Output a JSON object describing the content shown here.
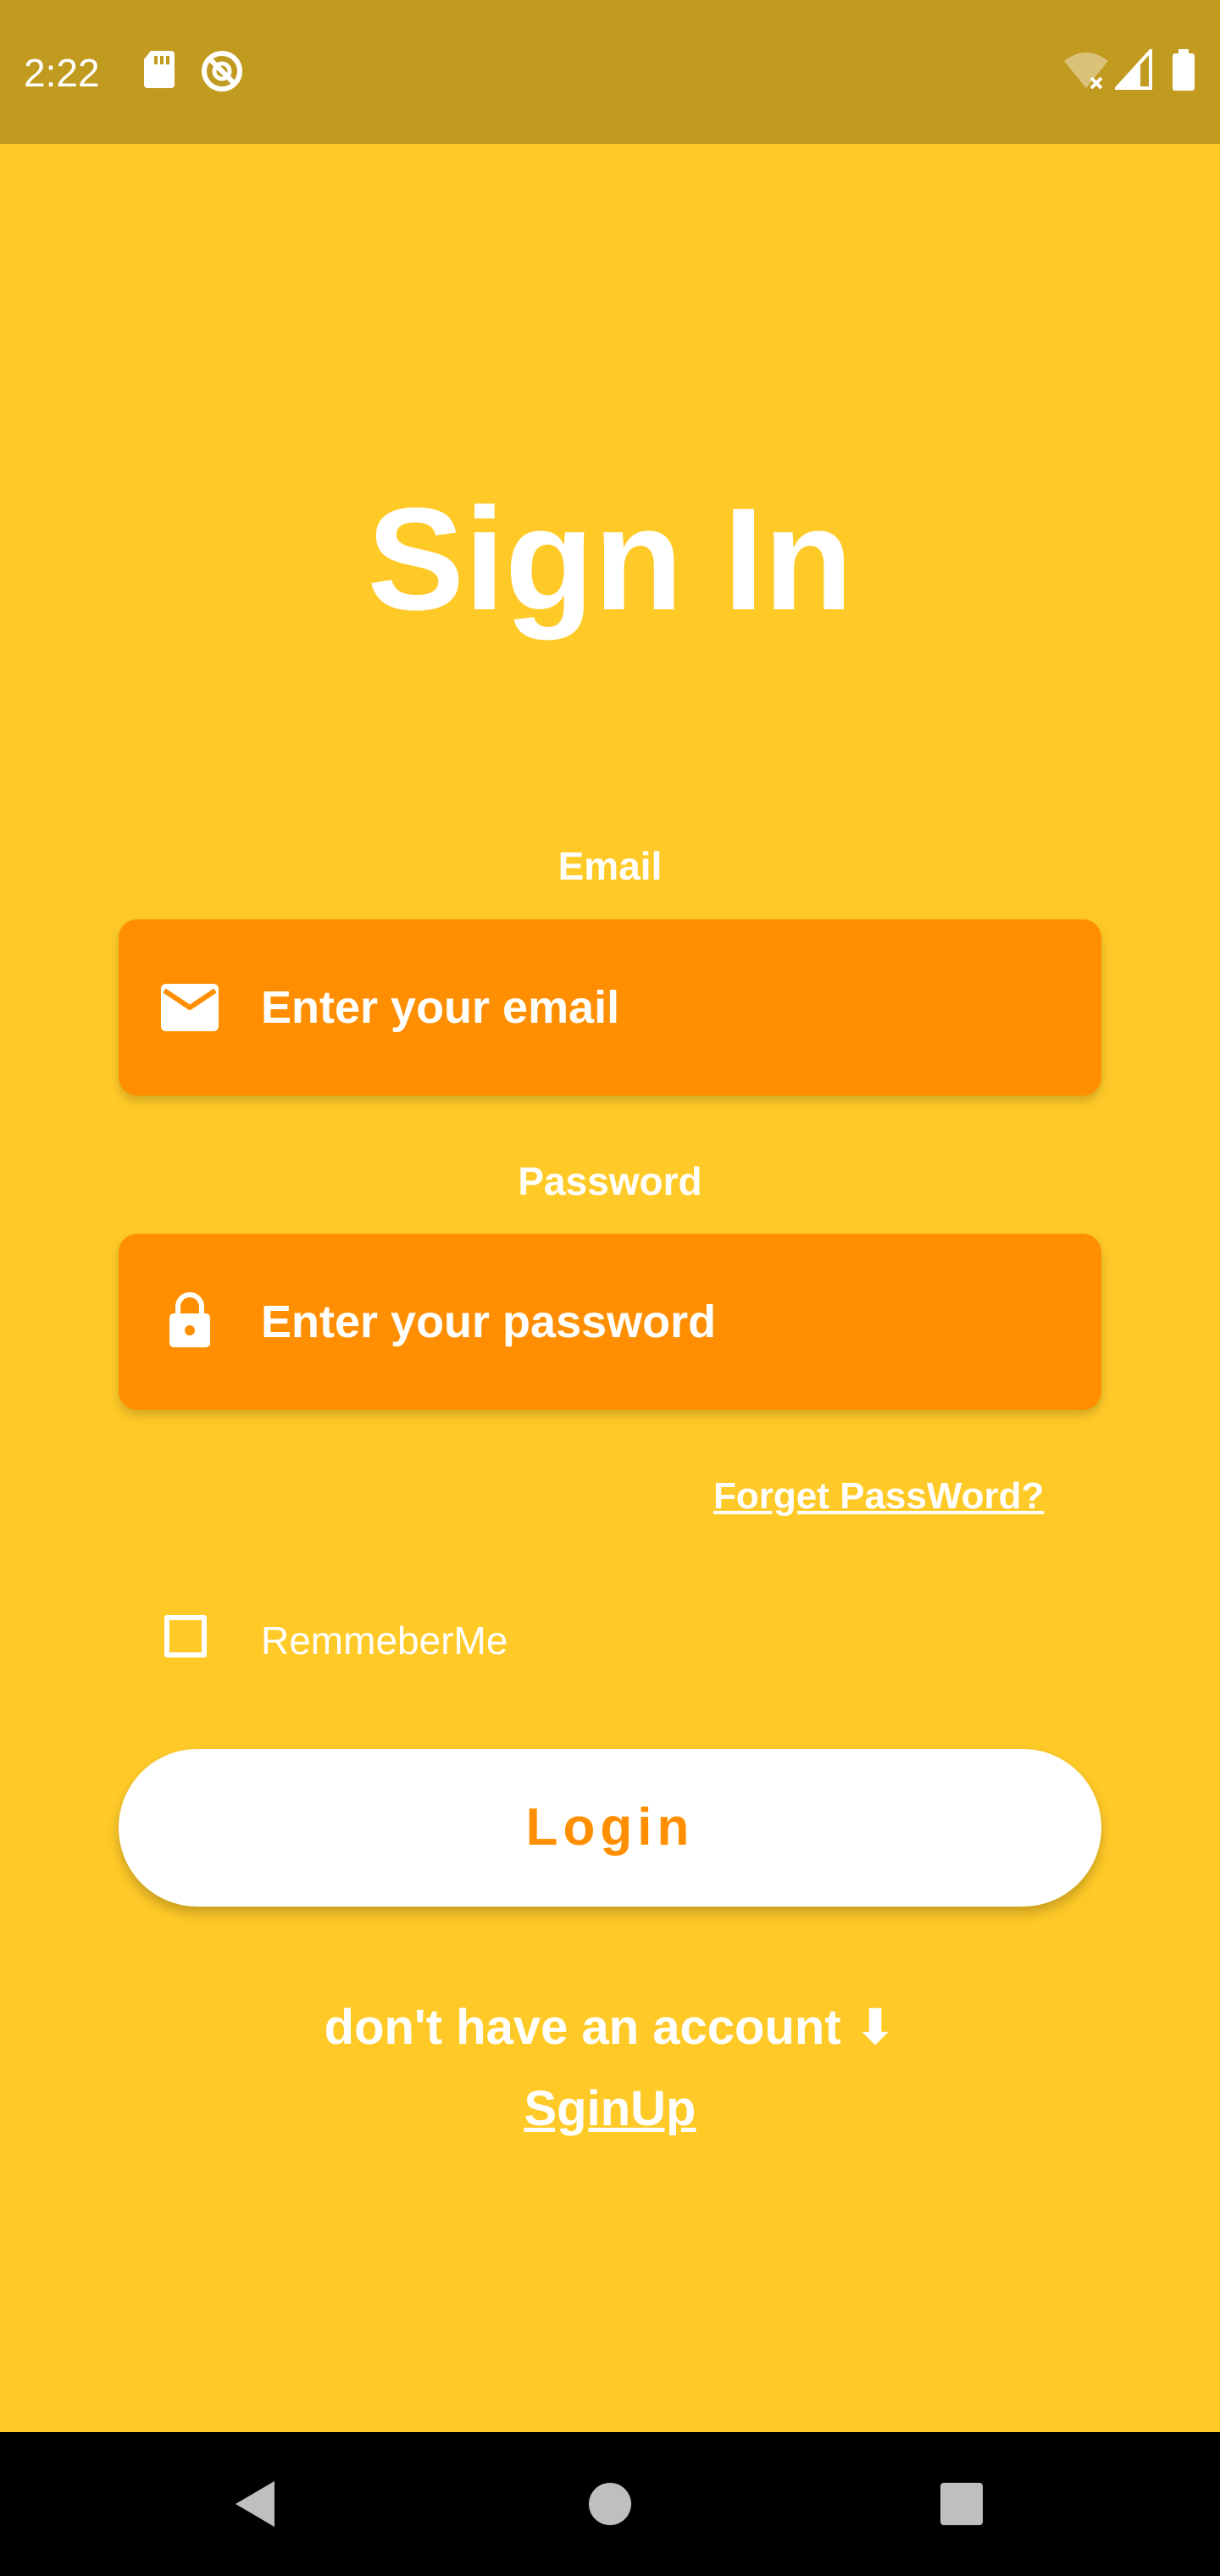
{
  "status_bar": {
    "time": "2:22",
    "icons": [
      "sd-card-icon",
      "do-not-disturb-icon",
      "wifi-off-icon",
      "cell-signal-icon",
      "battery-icon"
    ]
  },
  "page": {
    "title": "Sign In"
  },
  "email": {
    "label": "Email",
    "placeholder": "Enter your email",
    "icon": "mail-icon"
  },
  "password": {
    "label": "Password",
    "placeholder": "Enter your password",
    "icon": "lock-icon"
  },
  "forgot": {
    "label": "Forget PassWord?"
  },
  "remember": {
    "label": "RemmeberMe",
    "checked": false
  },
  "login": {
    "label": "Login"
  },
  "signup": {
    "prompt": "don't have an account ⬇",
    "link": "SginUp"
  },
  "nav_bar": {
    "buttons": [
      "back-icon",
      "home-icon",
      "recents-icon"
    ]
  },
  "colors": {
    "background": "#FFCA28",
    "status_bar": "#C19A20",
    "input_fill": "#FF8F00",
    "button_fill": "#FFFFFF",
    "button_text": "#FF8F00",
    "text": "#FFFFFF",
    "nav_bar": "#000000"
  }
}
